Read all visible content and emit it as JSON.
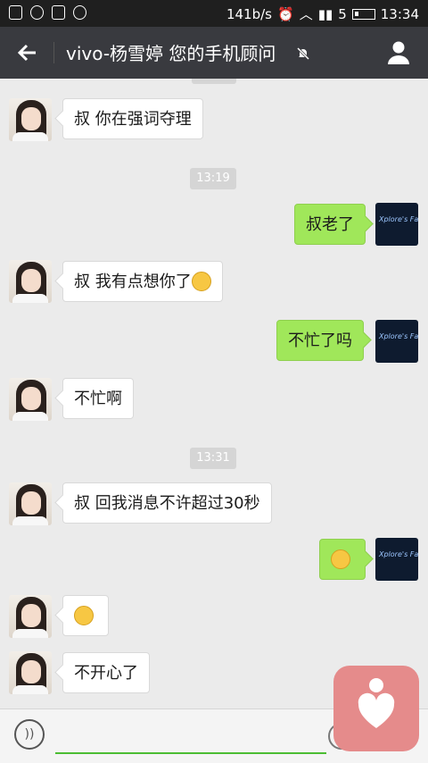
{
  "status_bar": {
    "net_speed": "141b/s",
    "signal_label": "5",
    "time": "13:34"
  },
  "title_bar": {
    "back_icon": "arrow-left-icon",
    "title": "vivo-杨雪婷 您的手机顾问",
    "mute_icon": "mute-bell-icon",
    "profile_icon": "person-icon"
  },
  "messages": [
    {
      "side": "in",
      "text": "叔 你在强词夺理"
    },
    {
      "side": "time",
      "text": "13:19"
    },
    {
      "side": "out",
      "text": "叔老了"
    },
    {
      "side": "in",
      "text": "叔 我有点想你了"
    },
    {
      "side": "out",
      "text": "不忙了吗"
    },
    {
      "side": "in",
      "text": "不忙啊"
    },
    {
      "side": "time",
      "text": "13:31"
    },
    {
      "side": "in",
      "text": "叔 回我消息不许超过30秒"
    },
    {
      "side": "out",
      "text": ""
    },
    {
      "side": "in",
      "text": ""
    },
    {
      "side": "in",
      "text": "不开心了"
    }
  ],
  "my_avatar_text": "Xplore's Fatema",
  "input_bar": {
    "voice_icon": "voice-icon",
    "placeholder": "",
    "emoji_icon": "emoji-icon"
  },
  "colors": {
    "header": "#393a3f",
    "background": "#ebebeb",
    "outgoing_bubble": "#a0e75a",
    "incoming_bubble": "#ffffff"
  }
}
